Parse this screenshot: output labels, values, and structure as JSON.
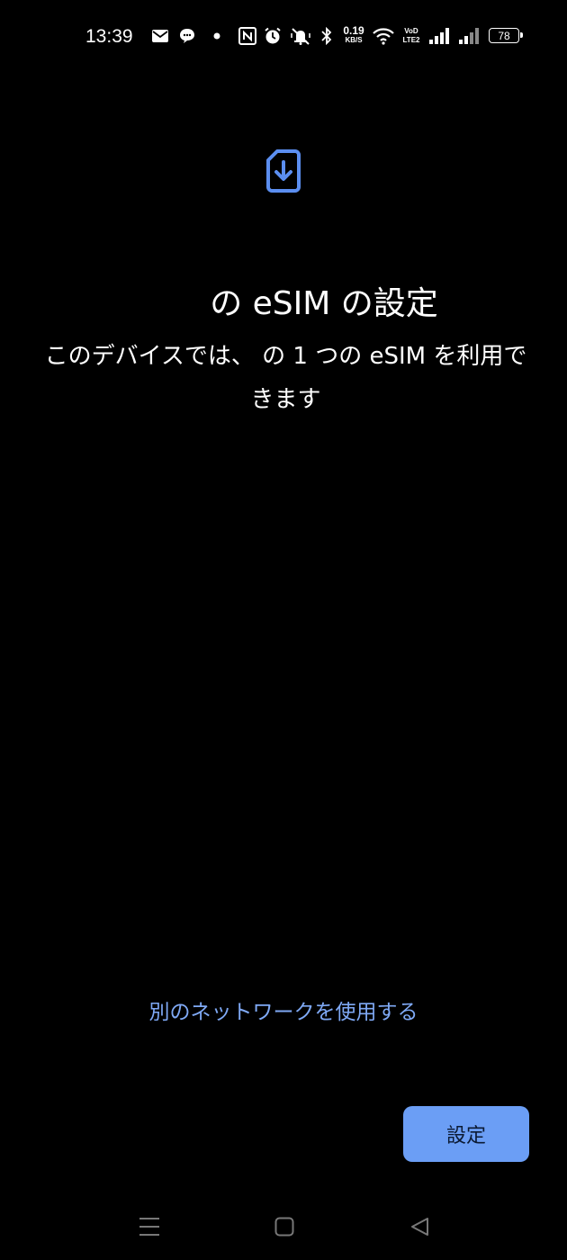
{
  "status_bar": {
    "time": "13:39",
    "net_speed_value": "0.19",
    "net_speed_unit": "KB/S",
    "volte_top": "VoD",
    "volte_bottom": "LTE2",
    "battery_level": "78",
    "icons": [
      "mail-icon",
      "chat-bubble-icon",
      "dot-icon",
      "nfc-icon",
      "alarm-icon",
      "mute-vibrate-icon",
      "bluetooth-icon",
      "wifi-icon",
      "signal-sim1-icon",
      "signal-sim2-icon",
      "battery-icon"
    ]
  },
  "main": {
    "icon": "esim-download-icon",
    "title": "の eSIM の設定",
    "subtitle": "このデバイスでは、 の 1 つの eSIM を利用できます",
    "alt_network_link": "別のネットワークを使用する",
    "setup_button": "設定"
  },
  "nav_bar": {
    "items": [
      "menu-icon",
      "home-icon",
      "back-icon"
    ]
  },
  "colors": {
    "background": "#000000",
    "accent": "#6b9ef5",
    "link": "#7fa9f5",
    "icon_blue": "#5b8ef0"
  }
}
